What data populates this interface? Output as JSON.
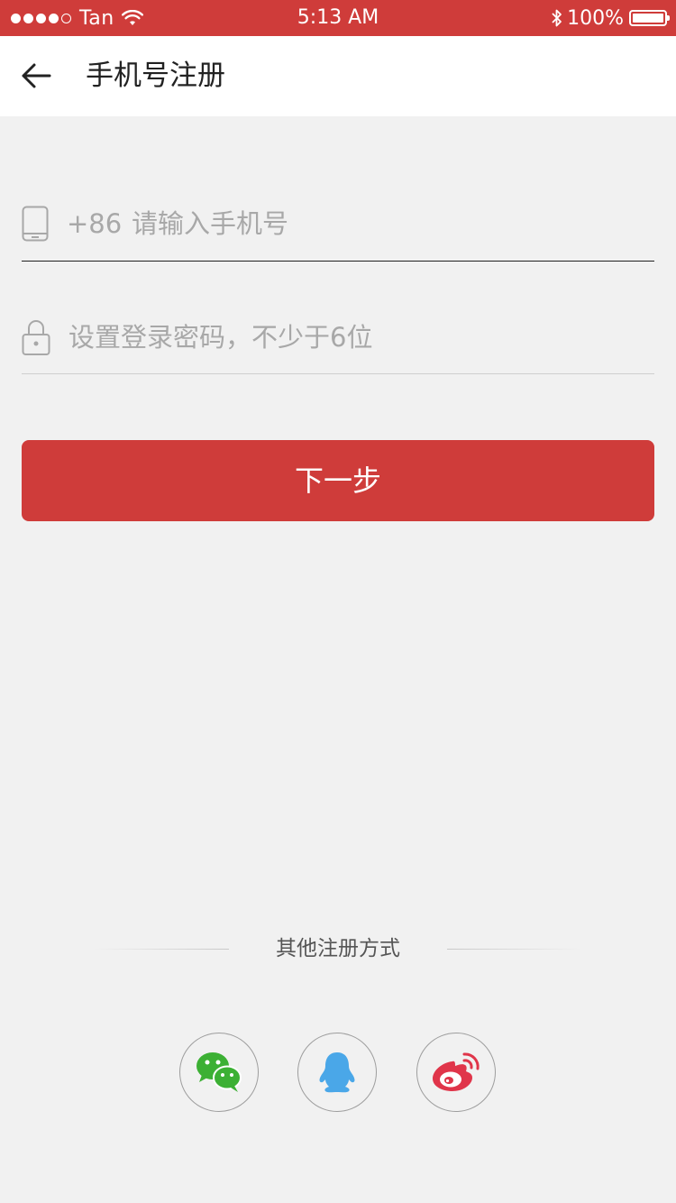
{
  "status_bar": {
    "carrier": "Tan",
    "time": "5:13 AM",
    "battery": "100%",
    "battery_level": 1.0,
    "background_color": "#cf3c3a"
  },
  "nav": {
    "back_icon": "arrow-left-icon",
    "title": "手机号注册"
  },
  "form": {
    "phone_icon": "phone-icon",
    "country_code": "+86",
    "phone_placeholder": "请输入手机号",
    "phone_value": "",
    "password_icon": "lock-icon",
    "password_placeholder": "设置登录密码，不少于6位",
    "password_value": "",
    "next_label": "下一步",
    "accent_color": "#cf3c3a"
  },
  "other_register": {
    "label": "其他注册方式",
    "options": [
      {
        "name": "wechat",
        "icon": "wechat-icon",
        "color": "#3cb034"
      },
      {
        "name": "qq",
        "icon": "qq-icon",
        "color": "#4aa7e8"
      },
      {
        "name": "weibo",
        "icon": "weibo-icon",
        "color": "#e0354a"
      }
    ]
  }
}
